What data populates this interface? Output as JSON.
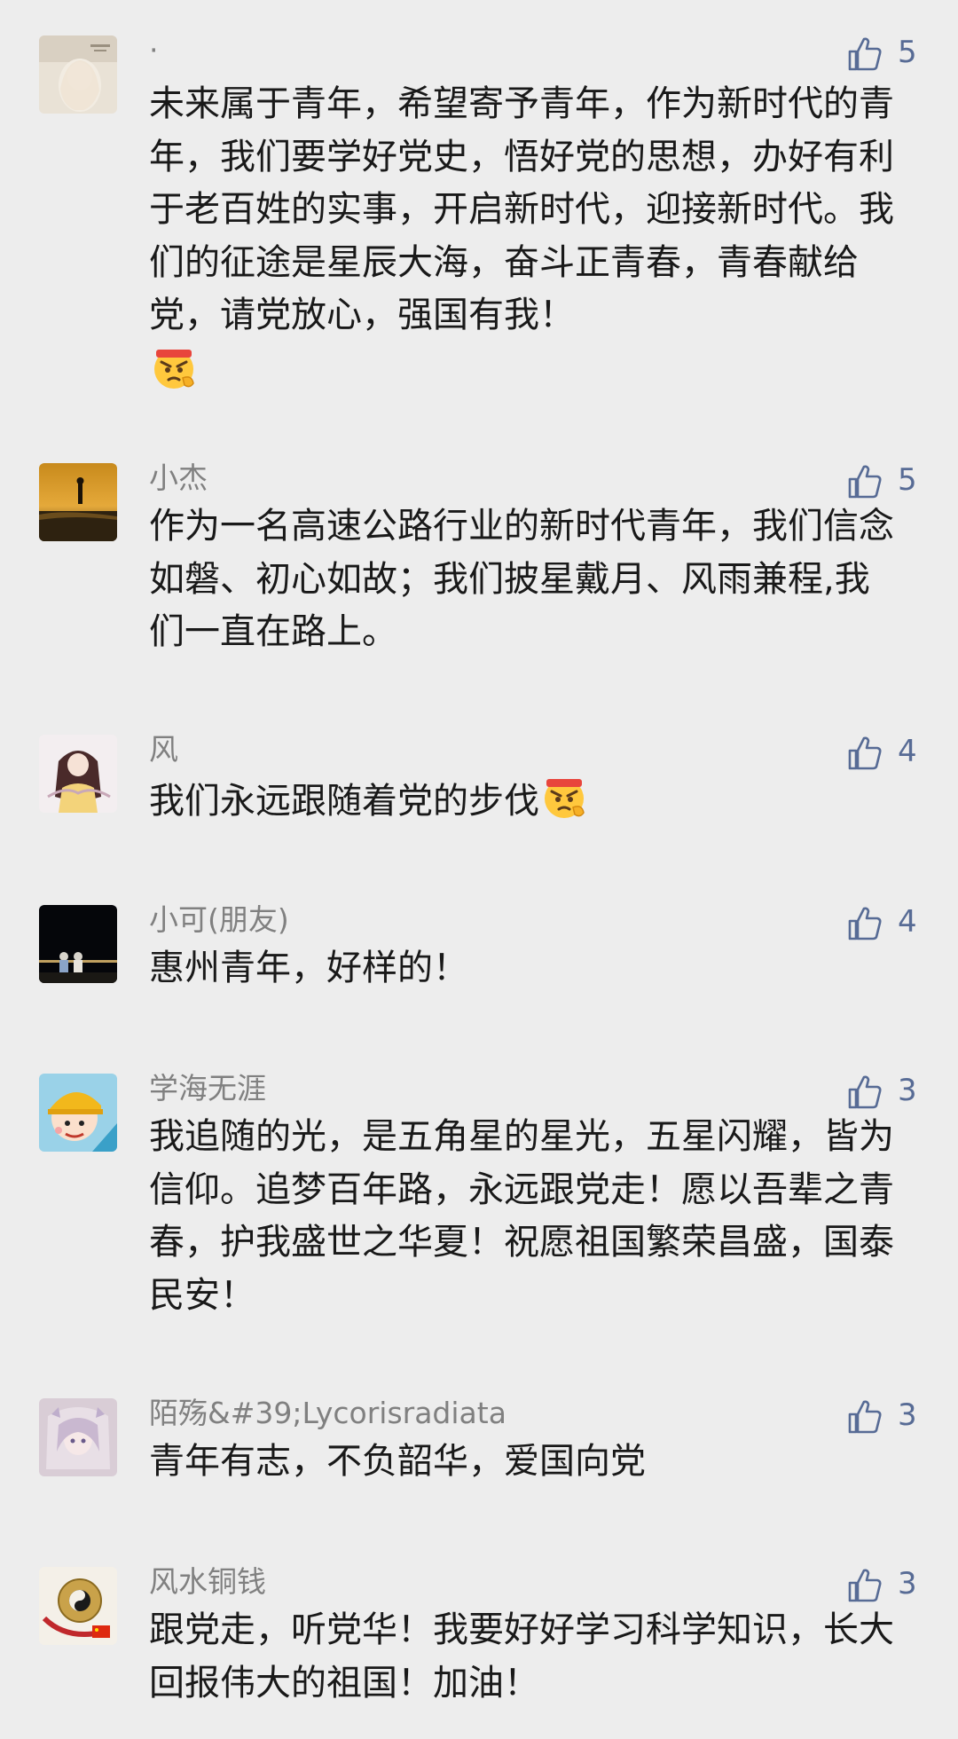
{
  "comments": [
    {
      "name": "·",
      "likes": "5",
      "text": "未来属于青年，希望寄予青年，作为新时代的青年，我们要学好党史，悟好党的思想，办好有利于老百姓的实事，开启新时代，迎接新时代。我们的征途是星辰大海，奋斗正青春，青春献给党，请党放心，强国有我！",
      "emoji": "determined-face-emoji"
    },
    {
      "name": "小杰",
      "likes": "5",
      "text": "作为一名高速公路行业的新时代青年，我们信念如磐、初心如故；我们披星戴月、风雨兼程,我们一直在路上。"
    },
    {
      "name": "风",
      "likes": "4",
      "text": "我们永远跟随着党的步伐",
      "emoji": "determined-face-emoji"
    },
    {
      "name": "小可(朋友)",
      "likes": "4",
      "text": "惠州青年，好样的！"
    },
    {
      "name": "学海无涯",
      "likes": "3",
      "text": "我追随的光，是五角星的星光，五星闪耀，皆为信仰。追梦百年路，永远跟党走！愿以吾辈之青春，护我盛世之华夏！祝愿祖国繁荣昌盛，国泰民安！"
    },
    {
      "name": "陌殇&#39;Lycorisradiata",
      "likes": "3",
      "text": "青年有志，不负韶华，爱国向党"
    },
    {
      "name": "风水铜钱",
      "likes": "3",
      "text": "跟党走，听党华！我要好好学习科学知识，长大回报伟大的祖国！加油！"
    }
  ],
  "icons": {
    "like": "thumbs-up-icon",
    "emoji": "determined-face-emoji"
  },
  "colors": {
    "background": "#ededed",
    "name": "#808080",
    "text": "#191919",
    "like": "#576b95"
  }
}
